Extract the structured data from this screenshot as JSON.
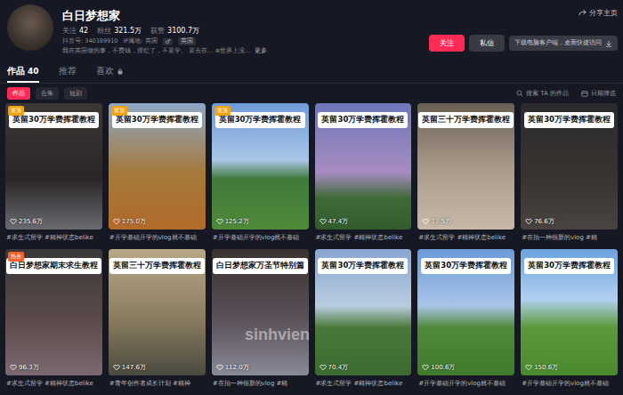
{
  "profile": {
    "name": "白日梦想家",
    "stats": [
      {
        "label": "关注",
        "value": "42"
      },
      {
        "label": "粉丝",
        "value": "321.5万"
      },
      {
        "label": "获赞",
        "value": "3100.7万"
      }
    ],
    "account_id": "抖音号: 340389910",
    "ip": "IP属地: 英国",
    "tags": [
      "♂",
      "英国"
    ],
    "bio": "我在英国做的事，不费钱，摆烂了，不要学。 要去在… ⊕世界上没…",
    "more": "更多"
  },
  "actions": {
    "share": "分享主页",
    "follow": "关注",
    "message": "私信",
    "download_hint": "下载电脑客户端，桌面快捷访问"
  },
  "tabs": [
    {
      "label": "作品",
      "count": "40",
      "locked": false,
      "selected": true
    },
    {
      "label": "推荐",
      "count": "",
      "locked": false,
      "selected": false
    },
    {
      "label": "喜欢",
      "count": "",
      "locked": true,
      "selected": false
    }
  ],
  "subtabs": [
    {
      "label": "作品",
      "selected": true
    },
    {
      "label": "合集",
      "selected": false
    },
    {
      "label": "短剧",
      "selected": false
    }
  ],
  "search": {
    "placeholder": "搜索 TA 的作品"
  },
  "filter": {
    "label": "日期筛选"
  },
  "videos": [
    {
      "title": "英留30万学费挥霍教程",
      "views": "235.6万",
      "caption": "#求生式留学 #精神状态belike",
      "badge": "置顶",
      "badge_color": "#f2a20c"
    },
    {
      "title": "英留30万学费挥霍教程",
      "views": "175.0万",
      "caption": "#开学基础开学的vlog就不基础",
      "badge": "置顶",
      "badge_color": "#f2a20c"
    },
    {
      "title": "英留30万学费挥霍教程",
      "views": "125.2万",
      "caption": "#开学基础开学的vlog就不基础",
      "badge": "置顶",
      "badge_color": "#f2a20c"
    },
    {
      "title": "英留30万学费挥霍教程",
      "views": "47.4万",
      "caption": "#求生式留学 #精神状态belike",
      "badge": "",
      "badge_color": ""
    },
    {
      "title": "英留三十万学费挥霍教程",
      "views": "33.5万",
      "caption": "#求生式留学 #精神状态belike",
      "badge": "",
      "badge_color": ""
    },
    {
      "title": "英留30万学费挥霍教程",
      "views": "76.6万",
      "caption": "#在拍一种很新的vlog #精",
      "badge": "",
      "badge_color": ""
    },
    {
      "title": "白日梦想家期末求生教程",
      "views": "96.3万",
      "caption": "#求生式留学 #精神状态belike",
      "badge": "热点",
      "badge_color": "#f2622a"
    },
    {
      "title": "英留三十万学费挥霍教程",
      "views": "147.6万",
      "caption": "#青年创作者成长计划 #精神",
      "badge": "",
      "badge_color": ""
    },
    {
      "title": "白日梦想家万圣节特别篇",
      "views": "112.0万",
      "caption": "#在拍一种很新的vlog #精",
      "badge": "",
      "badge_color": ""
    },
    {
      "title": "英留30万学费挥霍教程",
      "views": "70.4万",
      "caption": "#求生式留学 #精神状态belike",
      "badge": "",
      "badge_color": ""
    },
    {
      "title": "英留30万学费挥霍教程",
      "views": "100.6万",
      "caption": "#开学基础开学的vlog就不基础",
      "badge": "",
      "badge_color": ""
    },
    {
      "title": "英留30万学费挥霍教程",
      "views": "150.6万",
      "caption": "#开学基础开学的vlog就不基础",
      "badge": "",
      "badge_color": ""
    }
  ],
  "watermark": "sinhvien"
}
